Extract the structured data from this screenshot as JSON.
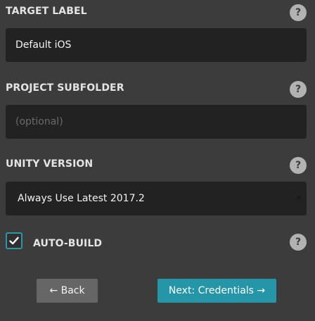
{
  "target_label": {
    "title": "TARGET LABEL",
    "help": "?",
    "value": "Default iOS"
  },
  "project_subfolder": {
    "title": "PROJECT SUBFOLDER",
    "help": "?",
    "value": "",
    "placeholder": "(optional)"
  },
  "unity_version": {
    "title": "UNITY VERSION",
    "help": "?",
    "selected": "Always Use Latest 2017.2"
  },
  "auto_build": {
    "label": "AUTO-BUILD",
    "help": "?",
    "checked": true
  },
  "footer": {
    "back_label": "← Back",
    "next_label": "Next: Credentials →"
  },
  "colors": {
    "background": "#3c3c3c",
    "field": "#222222",
    "accent": "#2596a8",
    "back_button": "#666666",
    "help_icon": "#b2b2b2"
  }
}
